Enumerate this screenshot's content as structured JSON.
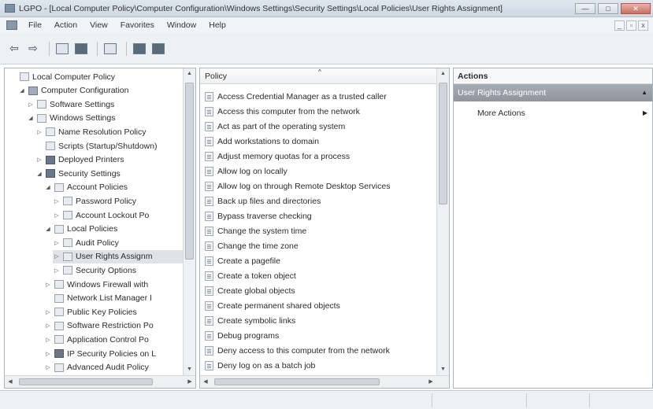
{
  "window": {
    "title": "LGPO - [Local Computer Policy\\Computer Configuration\\Windows Settings\\Security Settings\\Local Policies\\User Rights Assignment]",
    "minimize_label": "—",
    "maximize_label": "□",
    "close_label": "✕"
  },
  "menu": {
    "items": [
      "File",
      "Action",
      "View",
      "Favorites",
      "Window",
      "Help"
    ],
    "mdi_minimize": "_",
    "mdi_restore": "▫",
    "mdi_close": "x"
  },
  "toolbar": {
    "icons": [
      "back-arrow-icon",
      "forward-arrow-icon",
      "up-folder-icon",
      "show-hide-tree-icon",
      "export-list-icon",
      "properties-icon",
      "help-icon"
    ]
  },
  "tree": {
    "items": [
      {
        "label": "Local Computer Policy",
        "level": 0,
        "twisty": "",
        "icon": "policy"
      },
      {
        "label": "Computer Configuration",
        "level": 1,
        "twisty": "◢",
        "icon": "computer"
      },
      {
        "label": "Software Settings",
        "level": 2,
        "twisty": "▷",
        "icon": "folder"
      },
      {
        "label": "Windows Settings",
        "level": 2,
        "twisty": "◢",
        "icon": "folder"
      },
      {
        "label": "Name Resolution Policy",
        "level": 3,
        "twisty": "▷",
        "icon": "folder"
      },
      {
        "label": "Scripts (Startup/Shutdown)",
        "level": 3,
        "twisty": "",
        "icon": "folder"
      },
      {
        "label": "Deployed Printers",
        "level": 3,
        "twisty": "▷",
        "icon": "printer"
      },
      {
        "label": "Security Settings",
        "level": 3,
        "twisty": "◢",
        "icon": "security"
      },
      {
        "label": "Account Policies",
        "level": 4,
        "twisty": "◢",
        "icon": "folder"
      },
      {
        "label": "Password Policy",
        "level": 5,
        "twisty": "▷",
        "icon": "folder"
      },
      {
        "label": "Account Lockout Po",
        "level": 5,
        "twisty": "▷",
        "icon": "folder"
      },
      {
        "label": "Local Policies",
        "level": 4,
        "twisty": "◢",
        "icon": "folder"
      },
      {
        "label": "Audit Policy",
        "level": 5,
        "twisty": "▷",
        "icon": "folder"
      },
      {
        "label": "User Rights Assignm",
        "level": 5,
        "twisty": "▷",
        "icon": "folder",
        "selected": true
      },
      {
        "label": "Security Options",
        "level": 5,
        "twisty": "▷",
        "icon": "folder"
      },
      {
        "label": "Windows Firewall with",
        "level": 4,
        "twisty": "▷",
        "icon": "folder"
      },
      {
        "label": "Network List Manager I",
        "level": 4,
        "twisty": "",
        "icon": "folder"
      },
      {
        "label": "Public Key Policies",
        "level": 4,
        "twisty": "▷",
        "icon": "folder"
      },
      {
        "label": "Software Restriction Po",
        "level": 4,
        "twisty": "▷",
        "icon": "folder"
      },
      {
        "label": "Application Control Po",
        "level": 4,
        "twisty": "▷",
        "icon": "folder"
      },
      {
        "label": "IP Security Policies on L",
        "level": 4,
        "twisty": "▷",
        "icon": "security"
      },
      {
        "label": "Advanced Audit Policy",
        "level": 4,
        "twisty": "▷",
        "icon": "folder"
      }
    ]
  },
  "list": {
    "header": "Policy",
    "sort_indicator": "^",
    "items": [
      "Access Credential Manager as a trusted caller",
      "Access this computer from the network",
      "Act as part of the operating system",
      "Add workstations to domain",
      "Adjust memory quotas for a process",
      "Allow log on locally",
      "Allow log on through Remote Desktop Services",
      "Back up files and directories",
      "Bypass traverse checking",
      "Change the system time",
      "Change the time zone",
      "Create a pagefile",
      "Create a token object",
      "Create global objects",
      "Create permanent shared objects",
      "Create symbolic links",
      "Debug programs",
      "Deny access to this computer from the network",
      "Deny log on as a batch job"
    ]
  },
  "actions": {
    "header": "Actions",
    "group_label": "User Rights Assignment",
    "group_caret": "▲",
    "more_actions_label": "More Actions",
    "more_actions_caret": "▶"
  },
  "scroll": {
    "up": "▲",
    "down": "▼",
    "left": "◀",
    "right": "▶"
  }
}
